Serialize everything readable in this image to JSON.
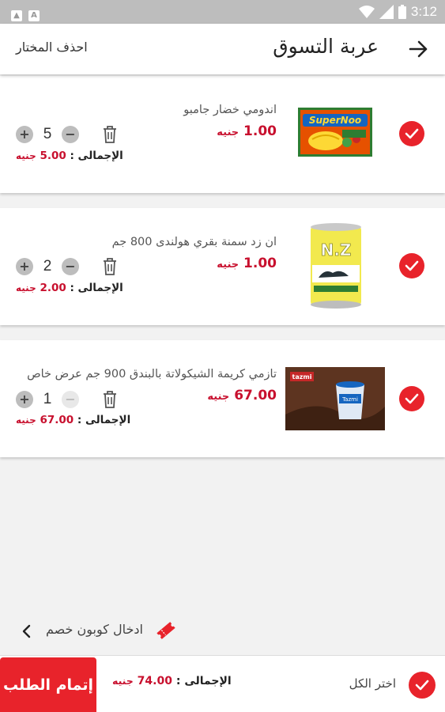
{
  "status_bar": {
    "time": "3:12"
  },
  "app_bar": {
    "title": "عربة التسوق",
    "delete_selected": "احذف المختار"
  },
  "cart_items": [
    {
      "name": "اندومي خضار جامبو",
      "price": "1.00",
      "currency": "جنيه",
      "quantity": "5",
      "total_label": "الإجمالى :",
      "total": "5.00",
      "selected": true,
      "minus_enabled": true
    },
    {
      "name": "ان زد سمنة بقري هولندى 800 جم",
      "price": "1.00",
      "currency": "جنيه",
      "quantity": "2",
      "total_label": "الإجمالى :",
      "total": "2.00",
      "selected": true,
      "minus_enabled": true
    },
    {
      "name": "تازمي كريمة الشيكولاتة بالبندق 900 جم عرض خاص",
      "price": "67.00",
      "currency": "جنيه",
      "quantity": "1",
      "total_label": "الإجمالى :",
      "total": "67.00",
      "selected": true,
      "minus_enabled": false
    }
  ],
  "coupon": {
    "label": "ادخال كوبون خصم",
    "icon": "ticket-icon"
  },
  "bottom_bar": {
    "select_all": "اختر الكل",
    "total_label": "الإجمالى :",
    "total": "74.00",
    "currency": "جنيه",
    "checkout": "إتمام الطلب"
  },
  "colors": {
    "accent": "#e8232b",
    "price": "#c8102e",
    "status_bar": "#bdbdbd"
  },
  "product_images": [
    "supernoodle-vegetable-pack",
    "nz-ghee-yellow-tin",
    "tazmi-chocolate-hazelnut-jar"
  ]
}
